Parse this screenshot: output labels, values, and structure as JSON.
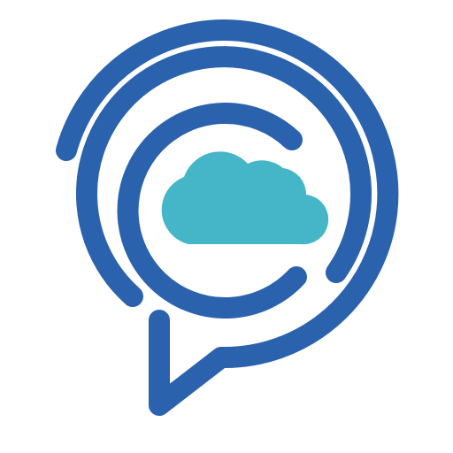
{
  "icon": {
    "name": "chat-cloud-app-icon",
    "elements": [
      "speech-bubble-icon",
      "concentric-arcs",
      "cloud-icon"
    ],
    "colors": {
      "background": "#ffffff",
      "bubble_stroke": "#2a62ae",
      "cloud_fill": "#45b6c8"
    }
  }
}
